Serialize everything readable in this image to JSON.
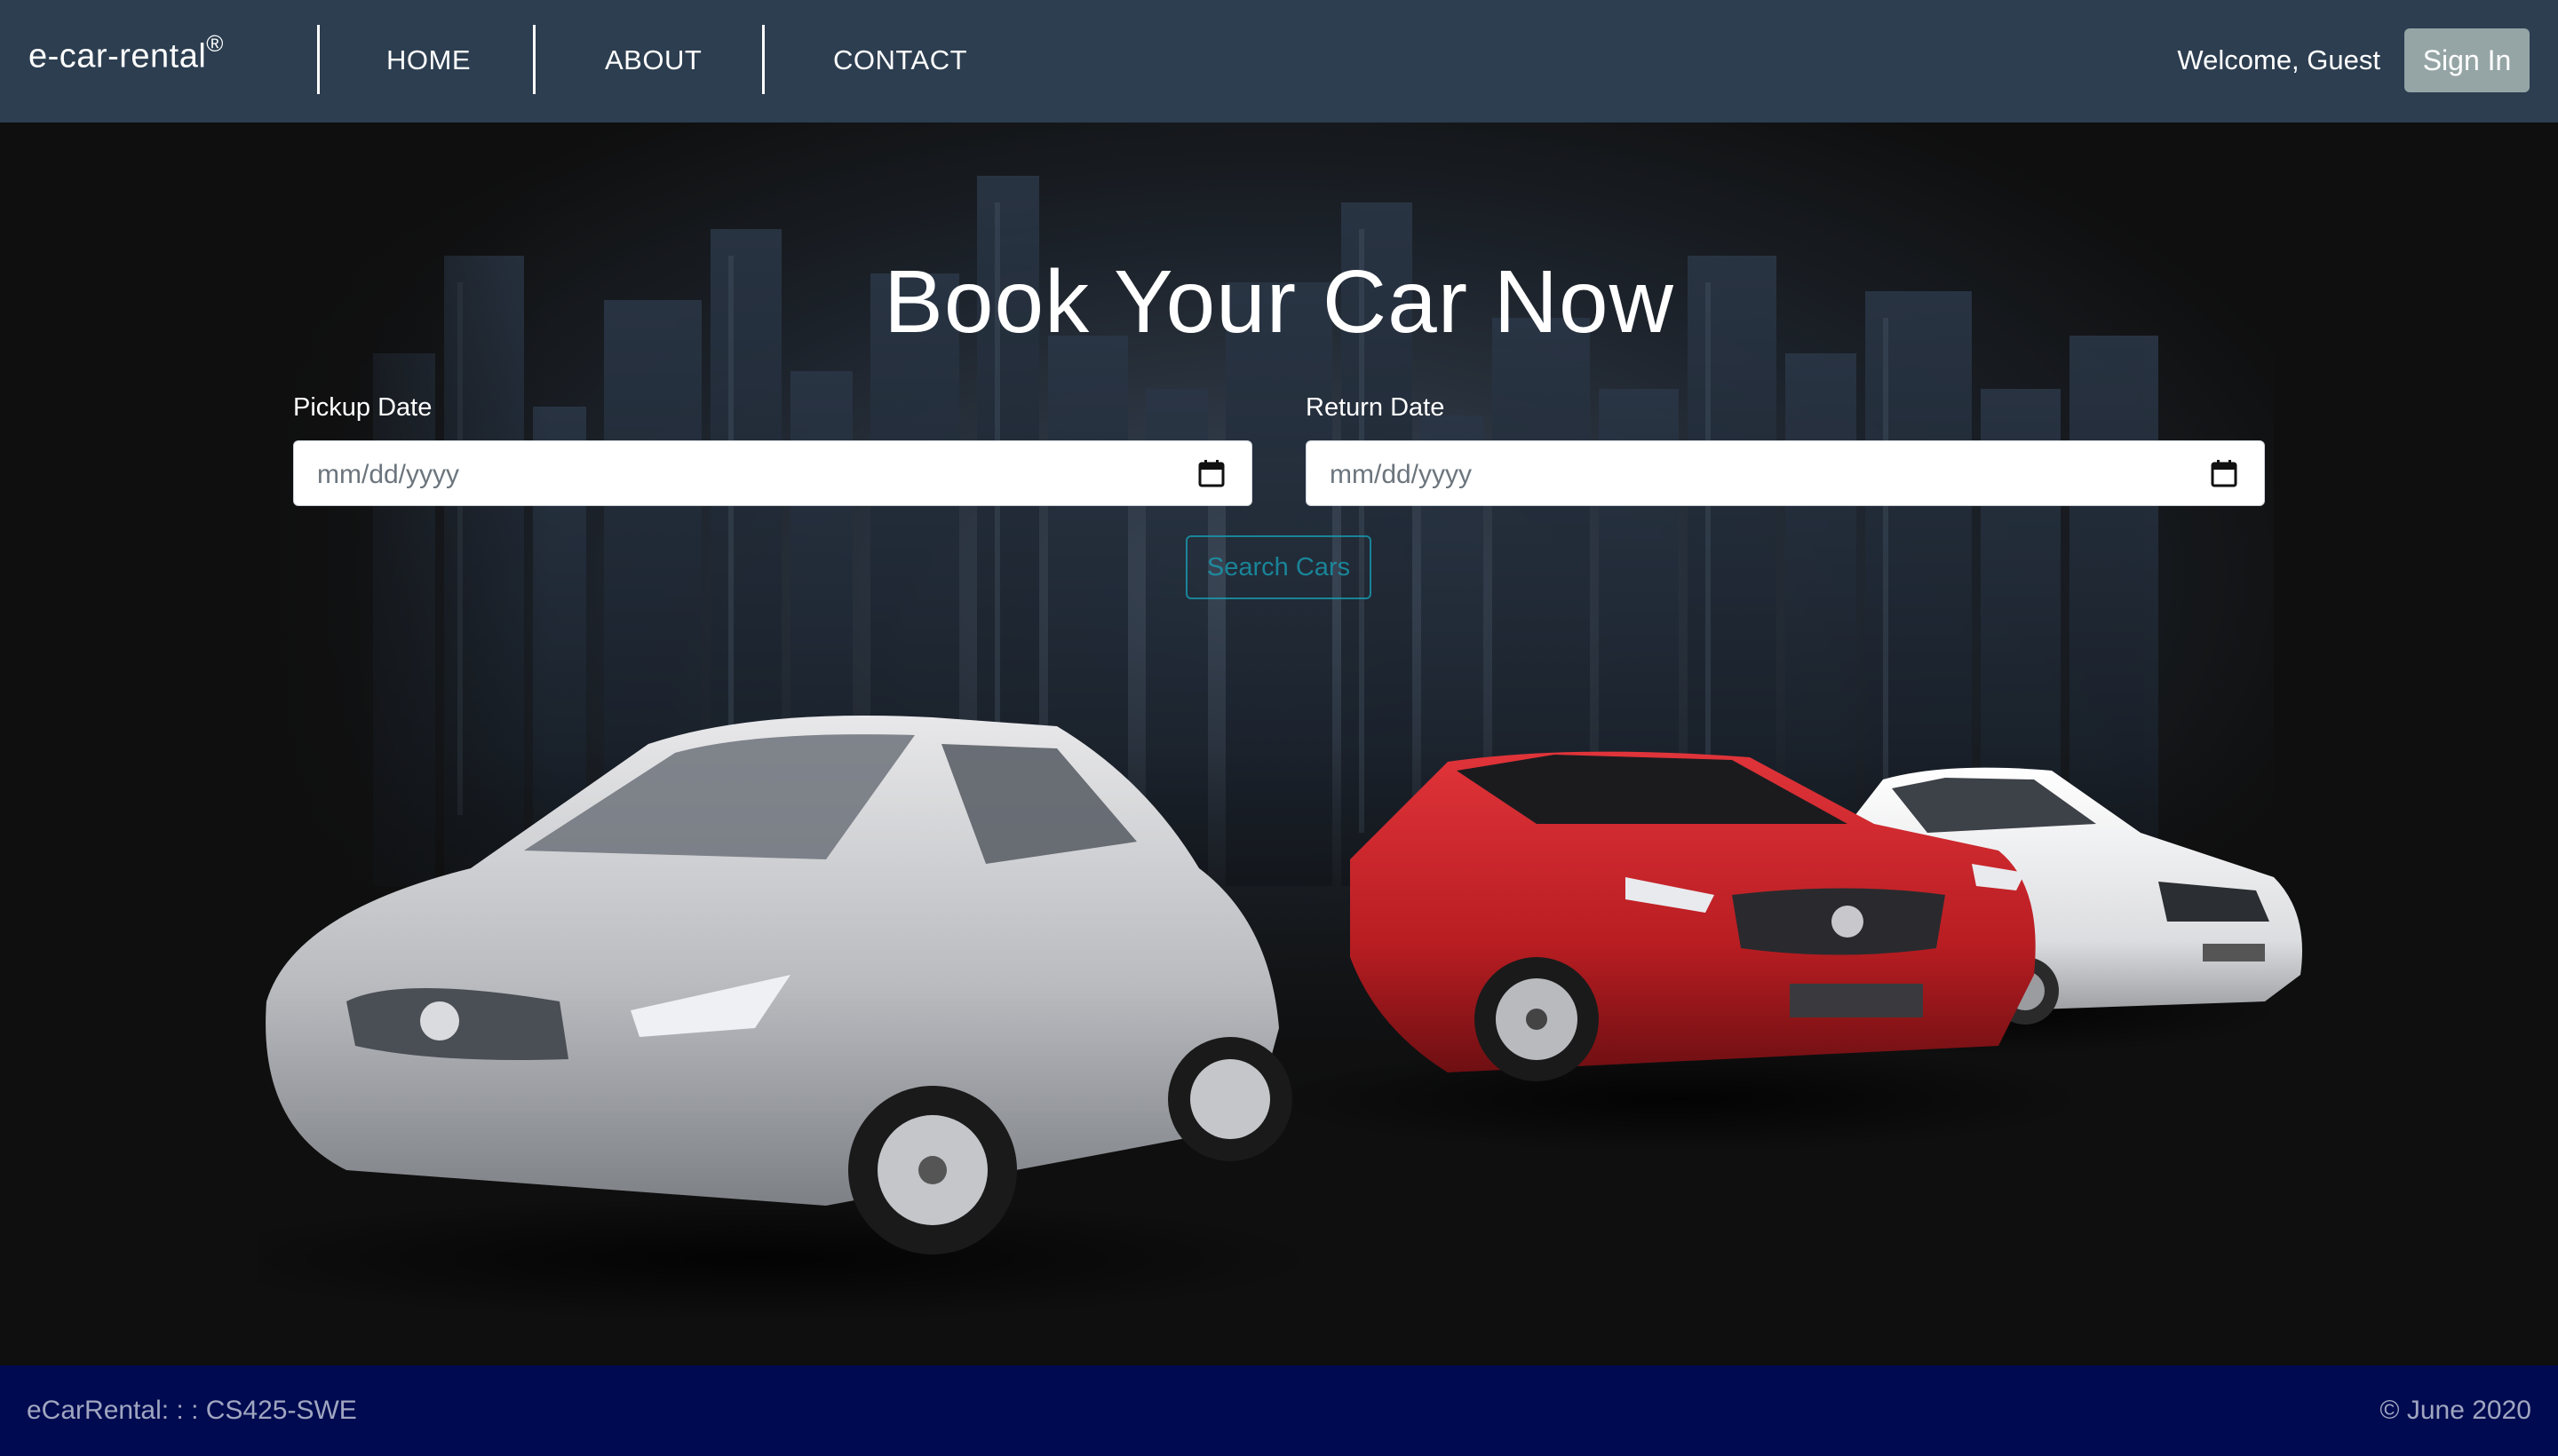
{
  "navbar": {
    "brand": "e-car-rental",
    "brand_mark": "®",
    "links": [
      "HOME",
      "ABOUT",
      "CONTACT"
    ],
    "welcome": "Welcome, Guest",
    "signin_label": "Sign In"
  },
  "hero": {
    "title": "Book Your Car Now",
    "pickup_label": "Pickup Date",
    "pickup_placeholder": "mm/dd/yyyy",
    "return_label": "Return Date",
    "return_placeholder": "mm/dd/yyyy",
    "search_label": "Search Cars",
    "calendar_icon": "calendar-icon"
  },
  "footer": {
    "left": "eCarRental: : : CS425-SWE",
    "right": "© June 2020"
  },
  "colors": {
    "navbar": "#2c3e50",
    "signin": "#95a5a6",
    "accent": "#17a2b8",
    "footer": "#000a50",
    "background": "#0f0f0f"
  }
}
